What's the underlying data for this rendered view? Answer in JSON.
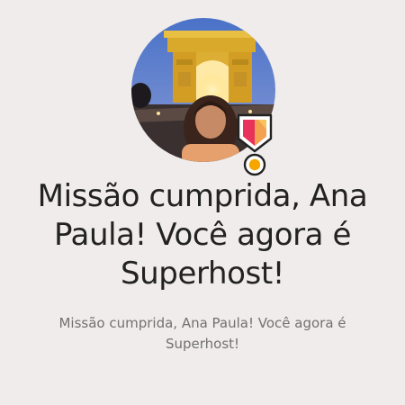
{
  "profile": {
    "avatar_description": "profile-photo",
    "badge_icon": "superhost-badge-icon"
  },
  "message": {
    "title": "Missão cumprida, Ana Paula! Você agora é Superhost!",
    "subtitle": "Missão cumprida, Ana Paula! Você agora é Superhost!"
  },
  "colors": {
    "background": "#f0eceb",
    "title_text": "#222222",
    "subtitle_text": "#717171",
    "badge_red": "#e8315b",
    "badge_orange": "#f7a600"
  }
}
